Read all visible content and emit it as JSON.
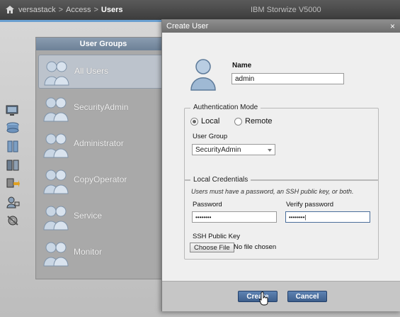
{
  "topbar": {
    "breadcrumbs": [
      "versastack",
      "Access",
      "Users"
    ],
    "product": "IBM Storwize V5000"
  },
  "user_groups": {
    "title": "User Groups",
    "items": [
      {
        "label": "All Users"
      },
      {
        "label": "SecurityAdmin"
      },
      {
        "label": "Administrator"
      },
      {
        "label": "CopyOperator"
      },
      {
        "label": "Service"
      },
      {
        "label": "Monitor"
      }
    ],
    "selected": "All Users"
  },
  "dialog": {
    "title": "Create User",
    "close": "×",
    "name_label": "Name",
    "name_value": "admin",
    "auth_mode": {
      "legend": "Authentication Mode",
      "local_label": "Local",
      "remote_label": "Remote",
      "selected": "Local",
      "group_label": "User Group",
      "group_value": "SecurityAdmin"
    },
    "credentials": {
      "legend": "Local Credentials",
      "note": "Users must have a password, an SSH public key, or both.",
      "password_label": "Password",
      "password_value": "••••••••",
      "verify_label": "Verify password",
      "verify_value": "••••••••|",
      "ssh_label": "SSH Public Key",
      "choose_file": "Choose File",
      "no_file": "No file chosen"
    },
    "buttons": {
      "create": "Create",
      "cancel": "Cancel"
    }
  },
  "colors": {
    "accent": "#4a6d9c",
    "topbar": "#4a4a4a",
    "panel_header": "#7a8da3"
  }
}
